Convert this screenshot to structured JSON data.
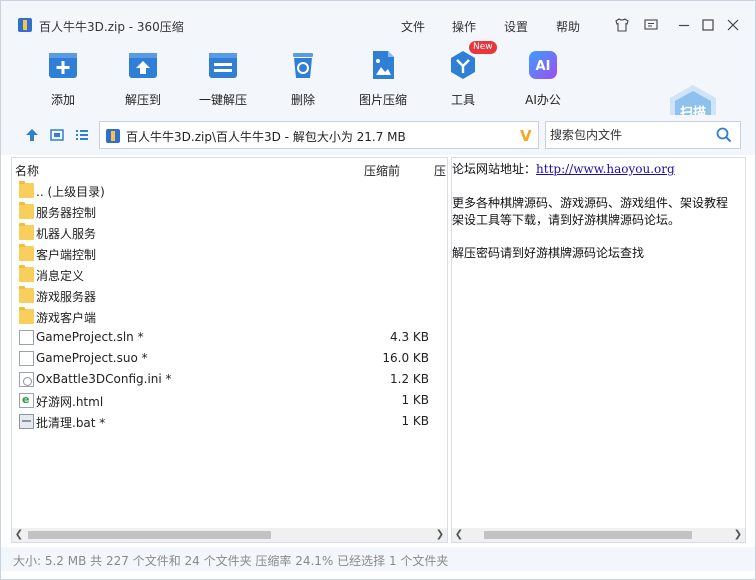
{
  "window": {
    "title": "百人牛牛3D.zip - 360压缩",
    "menu": [
      "文件",
      "操作",
      "设置",
      "帮助"
    ]
  },
  "toolbar": {
    "items": [
      {
        "label": "添加",
        "icon": "add-icon"
      },
      {
        "label": "解压到",
        "icon": "extract-to-icon"
      },
      {
        "label": "一键解压",
        "icon": "one-click-extract-icon"
      },
      {
        "label": "删除",
        "icon": "delete-icon"
      },
      {
        "label": "图片压缩",
        "icon": "image-compress-icon"
      },
      {
        "label": "工具",
        "icon": "tools-icon",
        "badge": "New"
      },
      {
        "label": "AI办公",
        "icon": "ai-office-icon",
        "icon_text": "AI"
      }
    ],
    "scan_label": "扫描"
  },
  "addressbar": {
    "path": "百人牛牛3D.zip\\百人牛牛3D - 解包大小为 21.7 MB",
    "search_placeholder": "搜索包内文件"
  },
  "filelist": {
    "headers": {
      "name": "名称",
      "compressed_before": "压缩前",
      "compressed_after": "压"
    },
    "rows": [
      {
        "name": ".. (上级目录)",
        "size": "",
        "type": "folder"
      },
      {
        "name": "服务器控制",
        "size": "",
        "type": "folder"
      },
      {
        "name": "机器人服务",
        "size": "",
        "type": "folder"
      },
      {
        "name": "客户端控制",
        "size": "",
        "type": "folder"
      },
      {
        "name": "消息定义",
        "size": "",
        "type": "folder"
      },
      {
        "name": "游戏服务器",
        "size": "",
        "type": "folder"
      },
      {
        "name": "游戏客户端",
        "size": "",
        "type": "folder"
      },
      {
        "name": "GameProject.sln *",
        "size": "4.3 KB",
        "type": "doc"
      },
      {
        "name": "GameProject.suo *",
        "size": "16.0 KB",
        "type": "doc"
      },
      {
        "name": "OxBattle3DConfig.ini *",
        "size": "1.2 KB",
        "type": "ini"
      },
      {
        "name": "好游网.html",
        "size": "1 KB",
        "type": "html"
      },
      {
        "name": "批清理.bat *",
        "size": "1 KB",
        "type": "bat"
      }
    ]
  },
  "comment": {
    "line1_prefix": "论坛网站地址：",
    "line1_link": "http://www.haoyou.org",
    "line2": "更多各种棋牌源码、游戏源码、游戏组件、架设教程",
    "line3": "架设工具等下载，请到好游棋牌源码论坛。",
    "line4": "解压密码请到好游棋牌源码论坛查找"
  },
  "status": {
    "text": "大小: 5.2 MB 共 227 个文件和 24 个文件夹 压缩率 24.1% 已经选择 1 个文件夹"
  },
  "colors": {
    "accent": "#2f7fd6",
    "chrome": "#f3f7fc",
    "folder": "#f8cf5d"
  }
}
